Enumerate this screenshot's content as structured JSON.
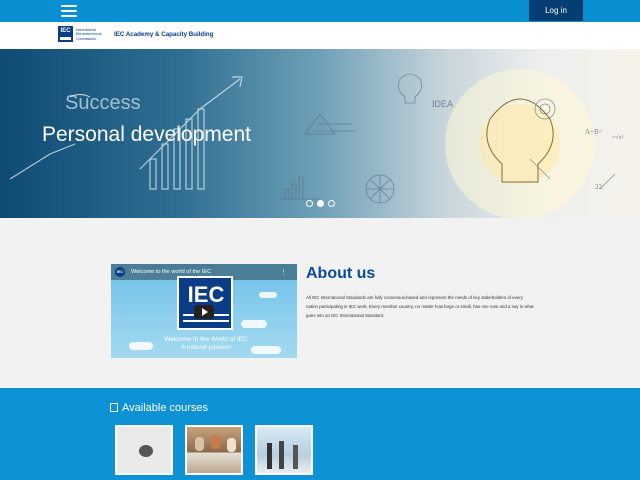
{
  "header": {
    "menu_icon": "hamburger-icon",
    "login_label": "Log in"
  },
  "brand": {
    "logo_text": "IEC",
    "org_name_lines": [
      "International",
      "Electrotechnical",
      "Commission"
    ],
    "site_title": "IEC Academy & Capacity Building"
  },
  "hero": {
    "slide_title": "Personal development",
    "slides": 3,
    "active_slide": 2
  },
  "video": {
    "channel_badge": "IEC",
    "title": "Welcome to the world of the IEC",
    "more_icon": "more-vert-icon",
    "logo_text": "IEC",
    "caption_line1": "Welcome to the World of IEC",
    "caption_line2": "A natural passion"
  },
  "about": {
    "title": "About us",
    "text": "All IEC International Standards are fully consensus-based and represent the needs of key stakeholders of every nation participating in IEC work. Every member country, no matter how large or small, has one vote and a say in what goes into an IEC International Standard."
  },
  "courses": {
    "icon": "book-icon",
    "title": "Available courses",
    "cards": [
      {
        "name": "course-card-1"
      },
      {
        "name": "course-card-2"
      },
      {
        "name": "course-card-3"
      }
    ]
  },
  "colors": {
    "topbar": "#0b8fd3",
    "login_bg": "#063e73",
    "brand_blue": "#0a3c88",
    "courses_bg": "#0e92d6"
  }
}
